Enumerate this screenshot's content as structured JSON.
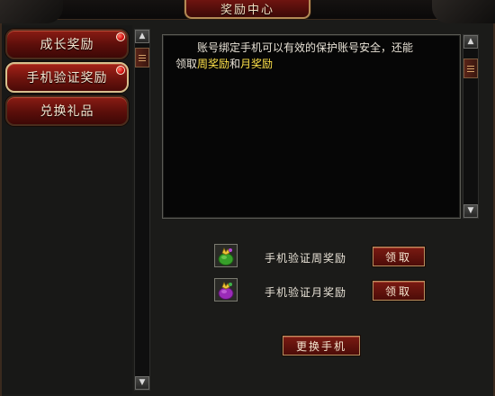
{
  "window": {
    "title": "奖励中心"
  },
  "nav": {
    "items": [
      {
        "label": "成长奖励",
        "badge": true,
        "active": false
      },
      {
        "label": "手机验证奖励",
        "badge": true,
        "active": true
      },
      {
        "label": "兑换礼品",
        "badge": false,
        "active": false
      }
    ]
  },
  "content": {
    "line1": "账号绑定手机可以有效的保护账号安全，还能",
    "line2_prefix": "领取",
    "line2_hl1": "周奖励",
    "line2_mid": "和",
    "line2_hl2": "月奖励",
    "highlight_color": "#ffe24a"
  },
  "rewards": [
    {
      "label": "手机验证周奖励",
      "button": "领取",
      "icon": "green-gift-bag-icon"
    },
    {
      "label": "手机验证月奖励",
      "button": "领取",
      "icon": "purple-gift-bag-icon"
    }
  ],
  "change_phone_button": "更换手机",
  "scroll_up_glyph": "▲",
  "scroll_down_glyph": "▼"
}
